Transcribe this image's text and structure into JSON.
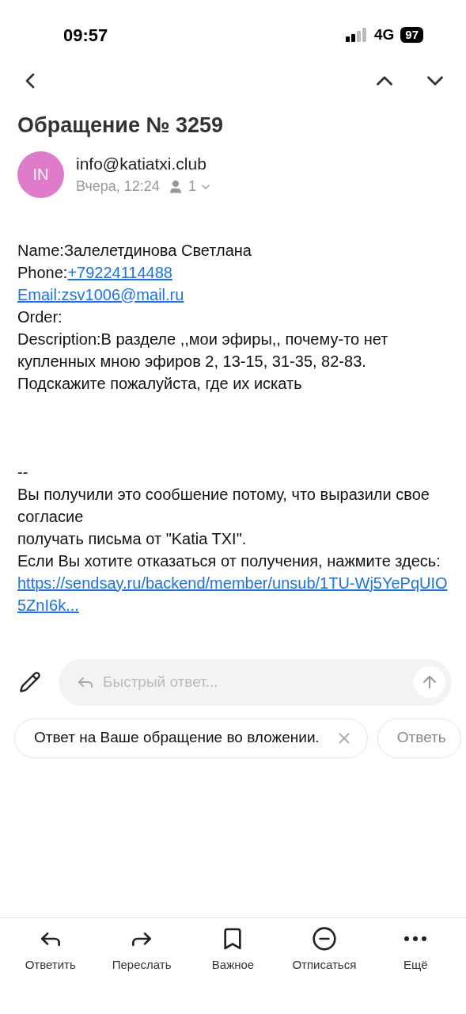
{
  "status_bar": {
    "time": "09:57",
    "network": "4G",
    "battery": "97"
  },
  "subject": "Обращение № 3259",
  "sender": {
    "initials": "IN",
    "email": "info@katiatxi.club",
    "date": "Вчера, 12:24",
    "recipients": "1"
  },
  "body": [
    {
      "kind": "text",
      "text": "Name:Залелетдинова Светлана"
    },
    {
      "kind": "field",
      "label": "Phone:",
      "link": "+79224114488"
    },
    {
      "kind": "link",
      "text": "Email:zsv1006@mail.ru"
    },
    {
      "kind": "text",
      "text": "Order:"
    },
    {
      "kind": "text",
      "text": "Description:В разделе ,,мои эфиры,, почему-то нет купленных мною эфиров 2, 13-15, 31-35, 82-83. Подскажите пожалуйста, где их искать"
    },
    {
      "kind": "gap"
    },
    {
      "kind": "text",
      "text": "--"
    },
    {
      "kind": "text",
      "text": "Вы получили это сообшение потому, что выразили свое согласие"
    },
    {
      "kind": "text",
      "text": "получать письма от \"Katia TXI\"."
    },
    {
      "kind": "text",
      "text": "Если Вы хотите отказаться от получения, нажмите здесь:"
    },
    {
      "kind": "url",
      "text": "https://sendsay.ru/backend/member/unsub/1TU-Wj5YePqUIO5ZnI6k..."
    }
  ],
  "quick_reply": {
    "placeholder": "Быстрый ответ..."
  },
  "suggestions": [
    {
      "text": "Ответ на Ваше обращение во вложении.",
      "closable": true
    },
    {
      "text": "Ответь",
      "closable": false
    }
  ],
  "toolbar": [
    {
      "kind": "reply",
      "label": "Ответить"
    },
    {
      "kind": "forward",
      "label": "Переслать"
    },
    {
      "kind": "bookmark",
      "label": "Важное"
    },
    {
      "kind": "unsubscribe",
      "label": "Отписаться"
    },
    {
      "kind": "more",
      "label": "Ещё"
    }
  ]
}
